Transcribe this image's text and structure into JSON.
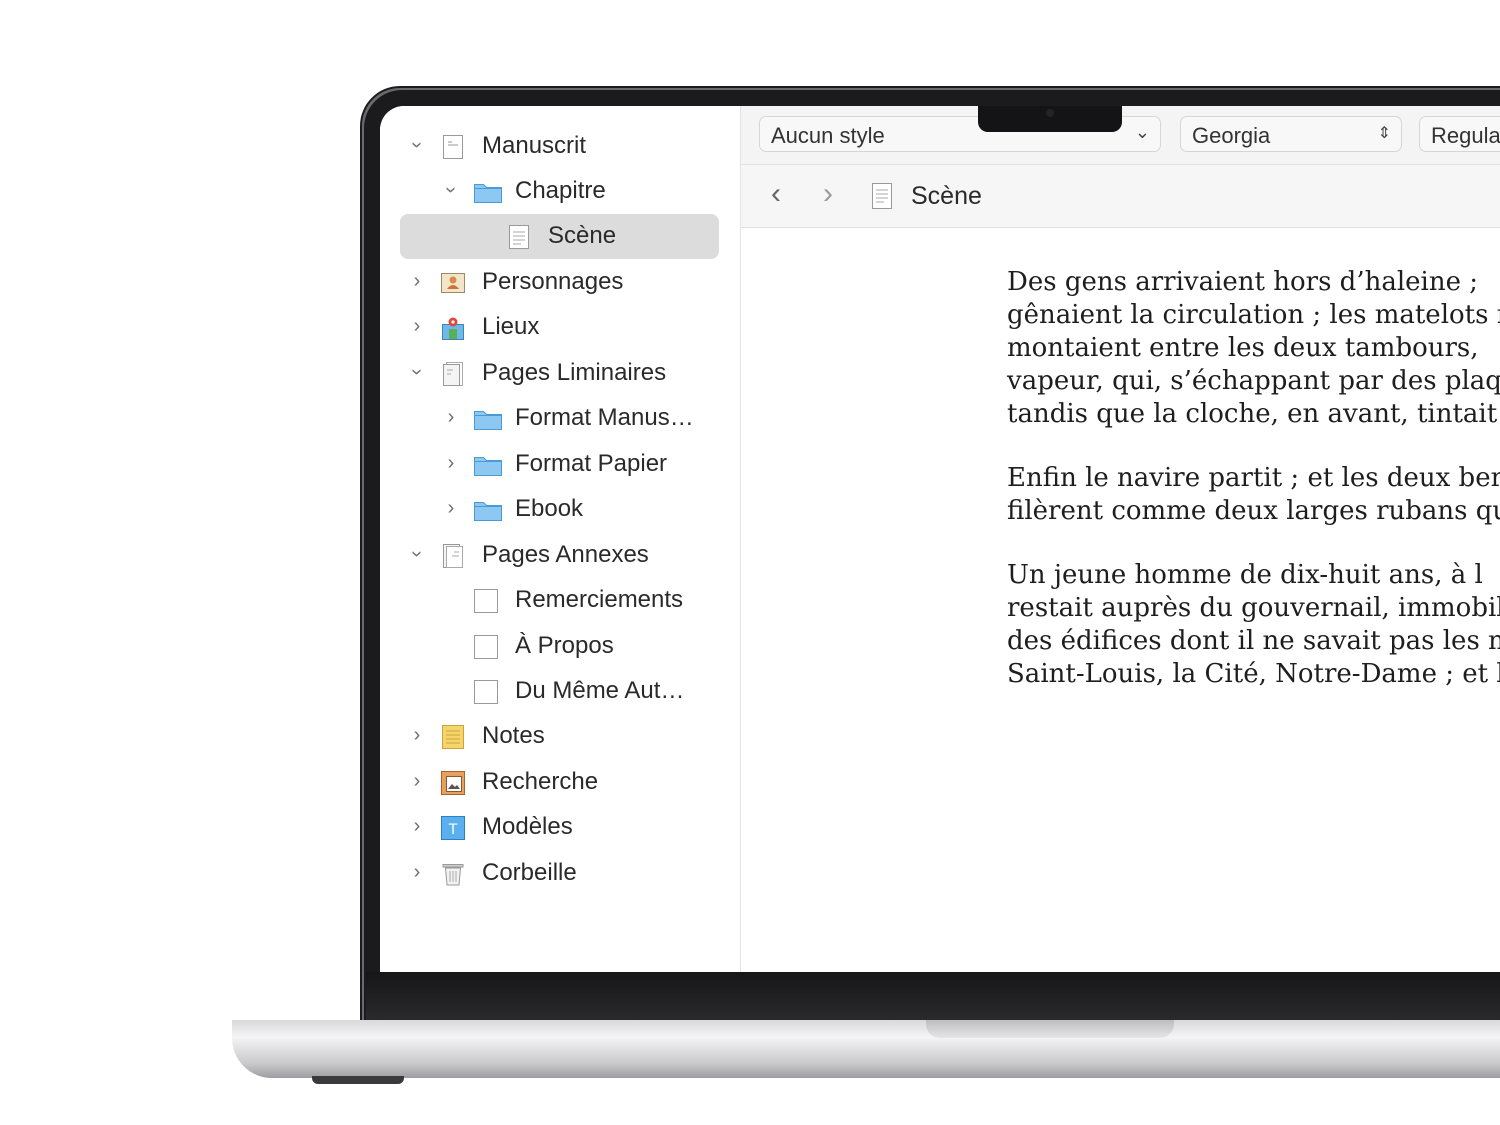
{
  "binder": {
    "items": [
      {
        "label": "Manuscrit",
        "icon": "manuscript-document-icon",
        "chevron": "expanded"
      },
      {
        "label": "Chapitre",
        "icon": "folder-icon",
        "chevron": "expanded"
      },
      {
        "label": "Scène",
        "icon": "text-document-icon",
        "selected": true
      },
      {
        "label": "Personnages",
        "icon": "character-card-icon",
        "chevron": "collapsed"
      },
      {
        "label": "Lieux",
        "icon": "map-places-icon",
        "chevron": "collapsed"
      },
      {
        "label": "Pages Liminaires",
        "icon": "front-matter-icon",
        "chevron": "expanded"
      },
      {
        "label": "Format Manus…",
        "icon": "folder-icon",
        "chevron": "collapsed"
      },
      {
        "label": "Format Papier",
        "icon": "folder-icon",
        "chevron": "collapsed"
      },
      {
        "label": "Ebook",
        "icon": "folder-icon",
        "chevron": "collapsed"
      },
      {
        "label": "Pages Annexes",
        "icon": "back-matter-icon",
        "chevron": "expanded"
      },
      {
        "label": "Remerciements",
        "icon": "blank-page-icon"
      },
      {
        "label": "À Propos",
        "icon": "blank-page-icon"
      },
      {
        "label": "Du Même Aut…",
        "icon": "blank-page-icon"
      },
      {
        "label": "Notes",
        "icon": "notebook-icon",
        "chevron": "collapsed"
      },
      {
        "label": "Recherche",
        "icon": "research-folder-icon",
        "chevron": "collapsed"
      },
      {
        "label": "Modèles",
        "icon": "templates-icon",
        "chevron": "collapsed"
      },
      {
        "label": "Corbeille",
        "icon": "trash-icon",
        "chevron": "collapsed"
      }
    ]
  },
  "format_bar": {
    "style": "Aucun style",
    "font": "Georgia",
    "weight": "Regular"
  },
  "nav_bar": {
    "doc_title": "Scène"
  },
  "document": {
    "paragraphs": [
      {
        "lines": [
          "Des gens arrivaient hors d’haleine ;",
          "gênaient la circulation ; les matelots r",
          "montaient entre les deux tambours,",
          "vapeur, qui, s’échappant par des plaq",
          "tandis que la cloche, en avant, tintait sa"
        ]
      },
      {
        "lines": [
          "Enfin le navire partit ; et les deux ber",
          "filèrent comme deux larges rubans que"
        ]
      },
      {
        "lines": [
          "Un jeune homme de dix-huit ans, à l",
          "restait auprès du gouvernail, immobile",
          "des édifices dont il ne savait pas les nor",
          "Saint-Louis, la Cité, Notre-Dame ; et bi"
        ]
      }
    ]
  },
  "colors": {
    "folder": "#8cc8f2",
    "selection": "#dcdcdc",
    "bezel": "#1b1b1d"
  }
}
